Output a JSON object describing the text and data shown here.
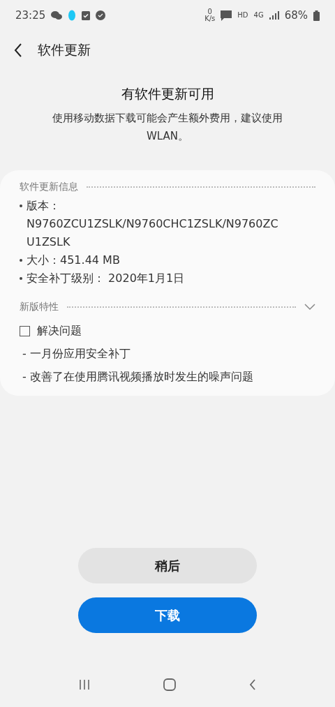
{
  "status_bar": {
    "time": "23:25",
    "speed_value": "0",
    "speed_unit": "K/s",
    "hd": "HD",
    "network": "4G",
    "battery": "68%"
  },
  "header": {
    "title": "软件更新"
  },
  "intro": {
    "title": "有软件更新可用",
    "message": "使用移动数据下载可能会产生额外费用，建议使用WLAN。"
  },
  "info_section": {
    "heading": "软件更新信息",
    "items": [
      {
        "label": "版本：",
        "value": "N9760ZCU1ZSLK/N9760CHC1ZSLK/N9760ZCU1ZSLK"
      },
      {
        "label": "大小：",
        "value": "451.44 MB"
      },
      {
        "label": "安全补丁级别：",
        "value": " 2020年1月1日"
      }
    ]
  },
  "features_section": {
    "heading": "新版特性",
    "expanded": true,
    "category": {
      "label": "解决问题",
      "checked": false
    },
    "items": [
      "- 一月份应用安全补丁",
      "- 改善了在使用腾讯视频播放时发生的噪声问题"
    ]
  },
  "buttons": [
    {
      "label": "稍后",
      "kind": "secondary"
    },
    {
      "label": "下载",
      "kind": "primary"
    }
  ]
}
